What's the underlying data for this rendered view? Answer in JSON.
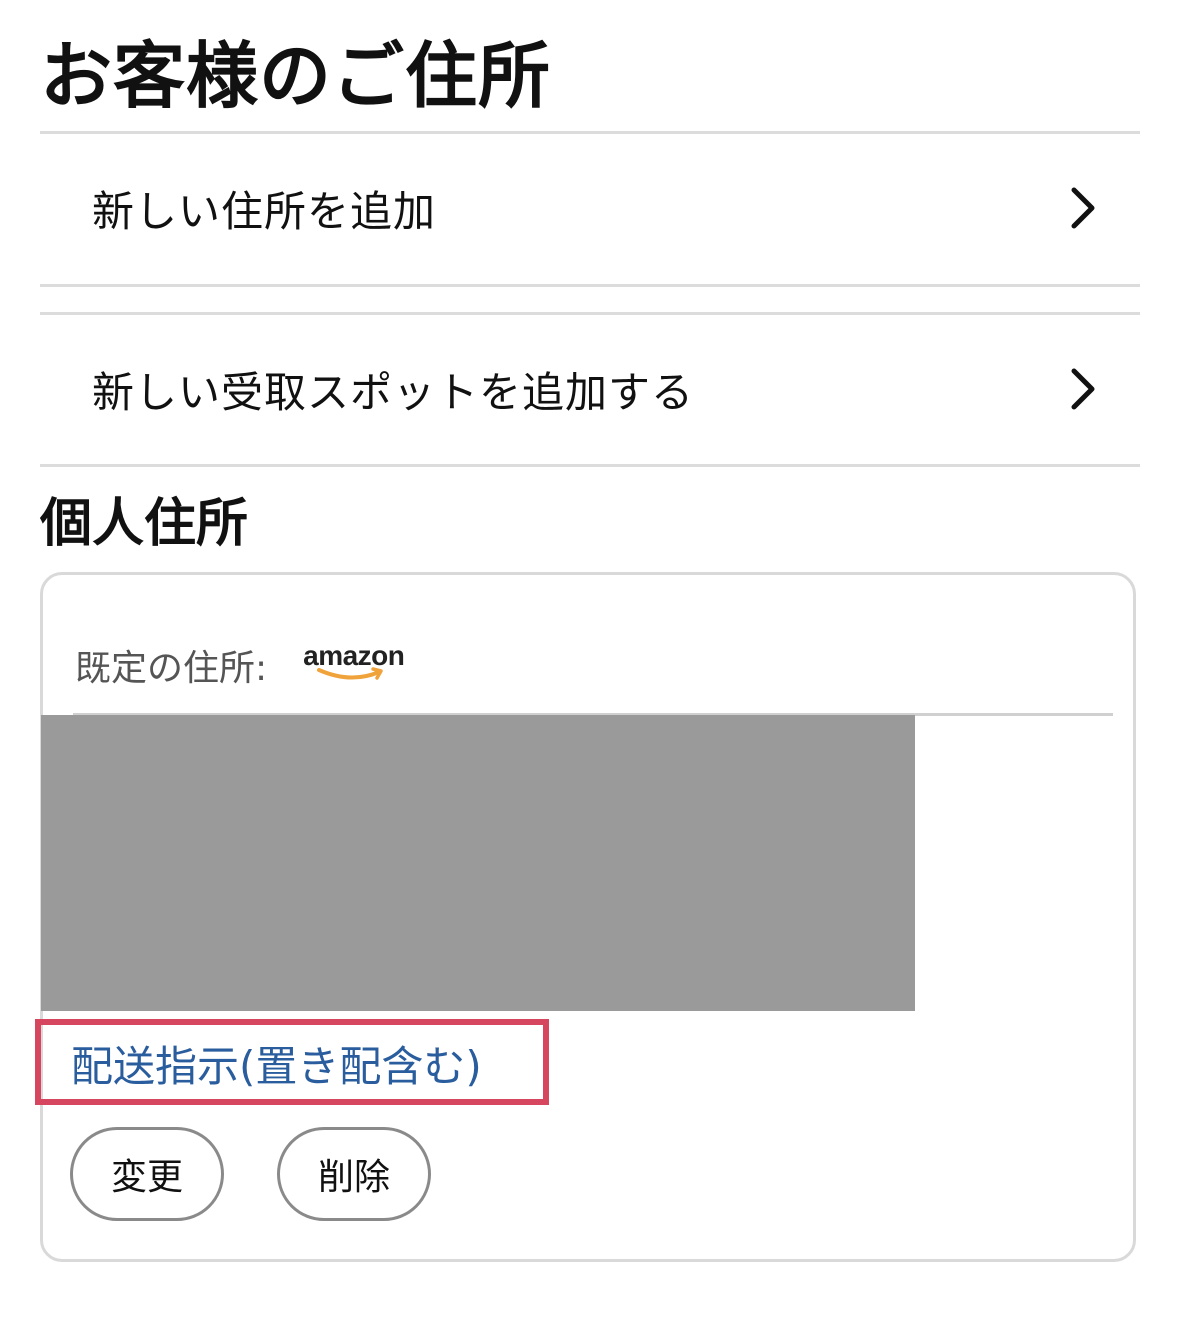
{
  "header": {
    "title": "お客様のご住所"
  },
  "actions": {
    "add_address": {
      "label": "新しい住所を追加",
      "chevron_icon": "chevron-right-icon"
    },
    "add_pickup_spot": {
      "label": "新しい受取スポットを追加する",
      "chevron_icon": "chevron-right-icon"
    }
  },
  "personal_section": {
    "title": "個人住所",
    "card": {
      "default_label": "既定の住所:",
      "brand_logo": {
        "text": "amazon",
        "icon": "amazon-smile-logo"
      },
      "redacted_address": "",
      "delivery_instructions_link": "配送指示(置き配含む)",
      "buttons": {
        "change": "変更",
        "delete": "削除"
      }
    }
  },
  "colors": {
    "link": "#2a5d9e",
    "highlight": "#d6465f",
    "redaction": "#9a9a9a",
    "logo_smile": "#f0a23b",
    "divider": "#dcdcdc"
  }
}
